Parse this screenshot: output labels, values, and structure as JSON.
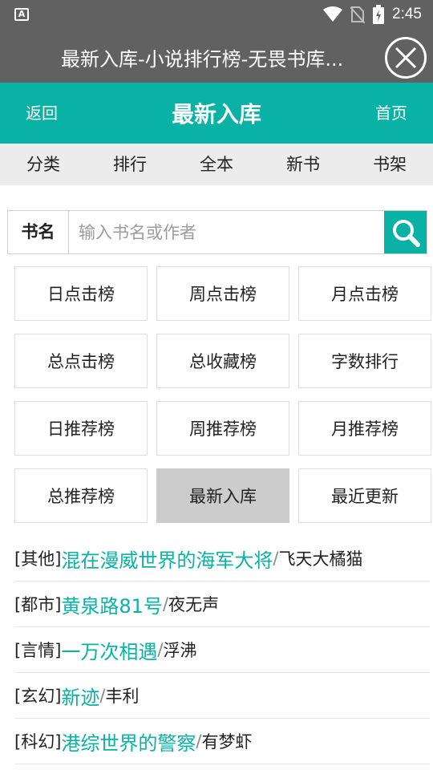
{
  "status_bar": {
    "app_icon_letter": "A",
    "time": "2:45"
  },
  "browser": {
    "page_title": "最新入库-小说排行榜-无畏书库..."
  },
  "header": {
    "back_label": "返回",
    "title": "最新入库",
    "home_label": "首页",
    "accent_color": "#09b2a5"
  },
  "nav": [
    "分类",
    "排行",
    "全本",
    "新书",
    "书架"
  ],
  "search": {
    "label": "书名",
    "placeholder": "输入书名或作者",
    "value": ""
  },
  "rankings": [
    {
      "label": "日点击榜",
      "active": false
    },
    {
      "label": "周点击榜",
      "active": false
    },
    {
      "label": "月点击榜",
      "active": false
    },
    {
      "label": "总点击榜",
      "active": false
    },
    {
      "label": "总收藏榜",
      "active": false
    },
    {
      "label": "字数排行",
      "active": false
    },
    {
      "label": "日推荐榜",
      "active": false
    },
    {
      "label": "周推荐榜",
      "active": false
    },
    {
      "label": "月推荐榜",
      "active": false
    },
    {
      "label": "总推荐榜",
      "active": false
    },
    {
      "label": "最新入库",
      "active": true
    },
    {
      "label": "最近更新",
      "active": false
    }
  ],
  "books": [
    {
      "category": "[其他]",
      "title": "混在漫威世界的海军大将",
      "separator": "/",
      "author": "飞天大橘猫"
    },
    {
      "category": "[都市]",
      "title": "黄泉路81号",
      "separator": "/",
      "author": "夜无声"
    },
    {
      "category": "[言情]",
      "title": "一万次相遇",
      "separator": "/",
      "author": "浮沸"
    },
    {
      "category": "[玄幻]",
      "title": "新迹",
      "separator": "/",
      "author": "丰利"
    },
    {
      "category": "[科幻]",
      "title": "港综世界的警察",
      "separator": "/",
      "author": "有梦虾"
    }
  ]
}
